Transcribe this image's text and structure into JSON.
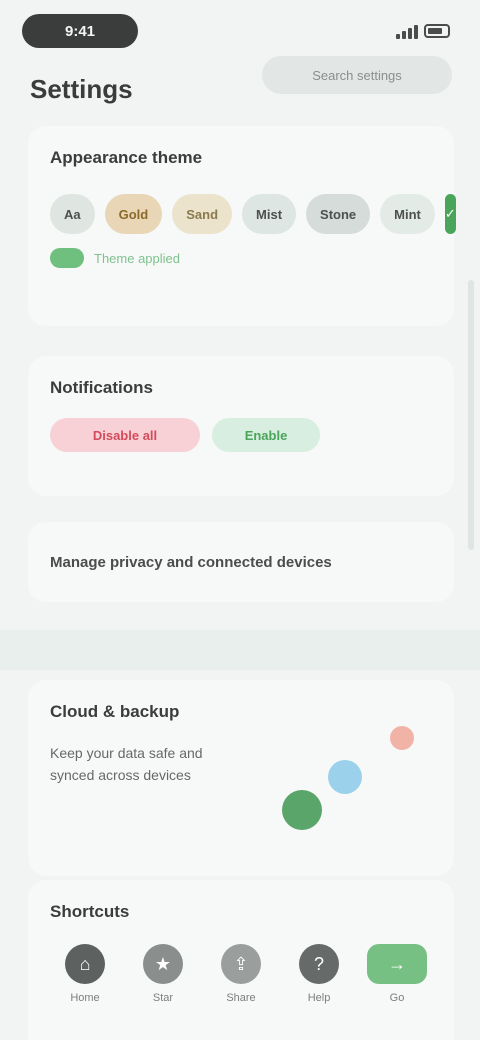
{
  "status_bar": {
    "time": "9:41"
  },
  "header": {
    "title": "Settings",
    "chip_text": "Search settings"
  },
  "cards": {
    "palette": {
      "title": "Appearance theme",
      "tokens": [
        "Aa",
        "Gold",
        "Sand",
        "Mist",
        "Stone",
        "Mint",
        "✓"
      ],
      "hint": "Theme applied"
    },
    "account": {
      "title": "Notifications",
      "red_pill": "Disable all",
      "green_pill": "Enable"
    },
    "privacy": {
      "link": "Manage privacy and connected devices"
    },
    "sync": {
      "title": "Cloud & backup",
      "description": "Keep your data safe and synced across devices"
    },
    "shortcuts": {
      "title": "Shortcuts",
      "items": [
        {
          "label": "Home"
        },
        {
          "label": "Star"
        },
        {
          "label": "Share"
        },
        {
          "label": "Help"
        },
        {
          "label": "Go"
        }
      ]
    }
  },
  "colors": {
    "accent": "#4aa55a",
    "danger": "#d44b5b",
    "background": "#f1f4f2"
  }
}
